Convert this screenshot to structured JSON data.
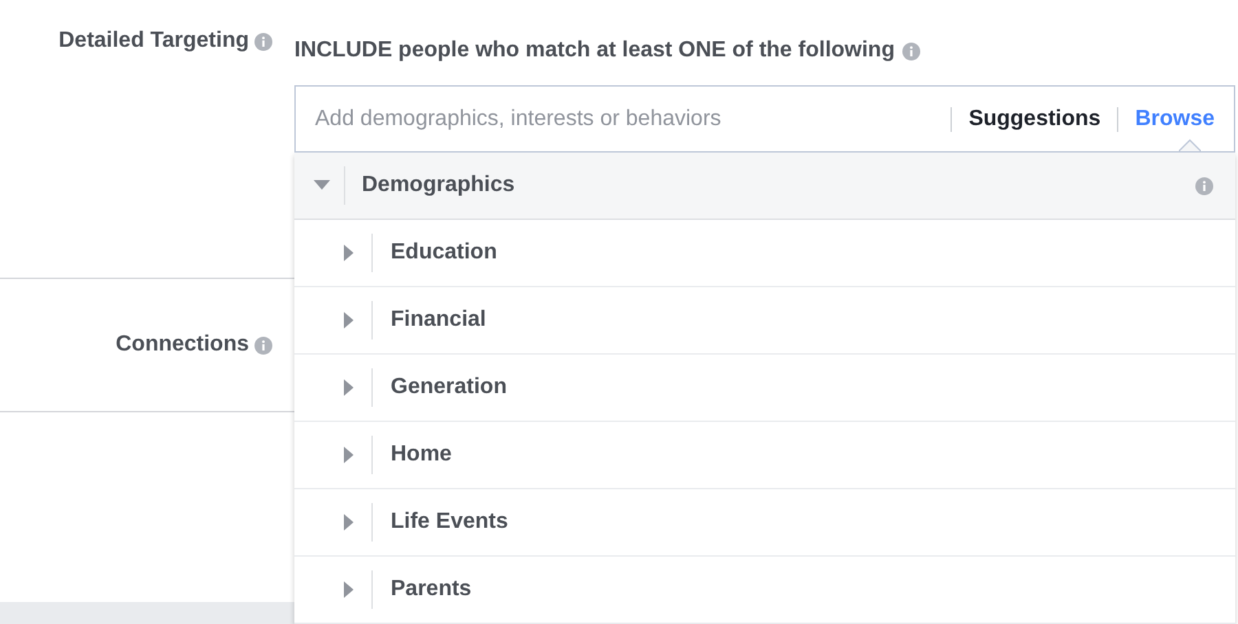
{
  "fields": [
    {
      "label": "Detailed Targeting"
    },
    {
      "label": "Connections"
    }
  ],
  "targeting": {
    "instruction": "INCLUDE people who match at least ONE of the following",
    "search": {
      "placeholder": "Add demographics, interests or behaviors"
    },
    "tabs": [
      {
        "label": "Suggestions",
        "selected": false
      },
      {
        "label": "Browse",
        "selected": true
      }
    ],
    "tree": [
      {
        "label": "Demographics",
        "expanded": true,
        "children": [
          {
            "label": "Education",
            "expanded": false
          },
          {
            "label": "Financial",
            "expanded": false
          },
          {
            "label": "Generation",
            "expanded": false
          },
          {
            "label": "Home",
            "expanded": false
          },
          {
            "label": "Life Events",
            "expanded": false
          },
          {
            "label": "Parents",
            "expanded": false
          }
        ]
      }
    ]
  }
}
